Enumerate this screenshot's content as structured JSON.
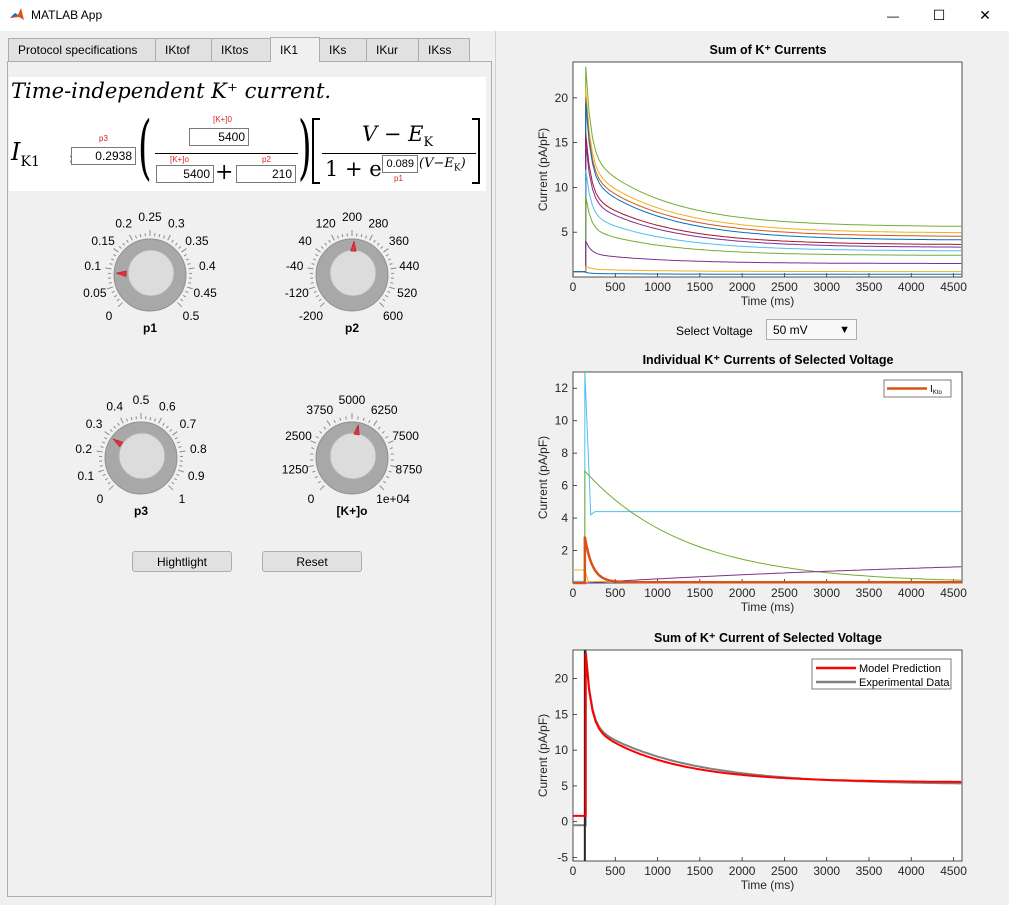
{
  "window": {
    "title": "MATLAB App",
    "minimize": "—",
    "maximize": "☐",
    "close": "✕"
  },
  "tabs": [
    "Protocol specifications",
    "IKtof",
    "IKtos",
    "IK1",
    "IKs",
    "IKur",
    "IKss"
  ],
  "active_tab": "IK1",
  "equation": {
    "title": "Time-independent K⁺ current.",
    "lhs": "I",
    "lhs_sub": "K1",
    "p3_label": "p3",
    "p3_value": "0.2938",
    "k_label_top": "[K+]0",
    "k_value_top": "5400",
    "k_label_bottom": "[K+]o",
    "k_value_bottom": "5400",
    "p2_label": "p2",
    "p2_value": "210",
    "numerator": "V − E",
    "numerator_sub": "K",
    "denominator_one": "1 + e",
    "p1_value": "0.089",
    "p1_label": "p1",
    "exponent_tail": "(V−E",
    "exponent_tail_sub": "K",
    "exponent_close": ")"
  },
  "knobs": {
    "p1": {
      "name": "p1",
      "ticks": [
        "0",
        "0.05",
        "0.1",
        "0.15",
        "0.2",
        "0.25",
        "0.3",
        "0.35",
        "0.4",
        "0.45",
        "0.5"
      ],
      "value": 0.089,
      "min": 0,
      "max": 0.5
    },
    "p2": {
      "name": "p2",
      "ticks": [
        "-200",
        "-120",
        "-40",
        "40",
        "120",
        "200",
        "280",
        "360",
        "440",
        "520",
        "600"
      ],
      "value": 210,
      "min": -200,
      "max": 600
    },
    "p3": {
      "name": "p3",
      "ticks": [
        "0",
        "0.1",
        "0.2",
        "0.3",
        "0.4",
        "0.5",
        "0.6",
        "0.7",
        "0.8",
        "0.9",
        "1"
      ],
      "value": 0.2938,
      "min": 0,
      "max": 1
    },
    "ko": {
      "name": "[K+]o",
      "ticks": [
        "0",
        "1250",
        "2500",
        "3750",
        "5000",
        "6250",
        "7500",
        "8750",
        "1e+04"
      ],
      "value": 5400,
      "min": 0,
      "max": 10000
    }
  },
  "buttons": {
    "highlight": "Hightlight",
    "reset": "Reset"
  },
  "select_voltage": {
    "label": "Select Voltage",
    "value": "50 mV",
    "arrow": "▼"
  },
  "colors": {
    "blue": "#0072bd",
    "orange": "#d95319",
    "yellow": "#edb120",
    "purple": "#7e2f8e",
    "green": "#77ac30",
    "cyan": "#4dbeee",
    "darkred": "#a2142f",
    "red": "#ff0000",
    "gray": "#808080"
  },
  "chart_data": [
    {
      "type": "line",
      "title": "Sum of K⁺ Currents",
      "xlabel": "Time (ms)",
      "ylabel": "Current (pA/pF)",
      "xlim": [
        0,
        4600
      ],
      "ylim": [
        0,
        24
      ],
      "xticks": [
        "0",
        "500",
        "1000",
        "1500",
        "2000",
        "2500",
        "3000",
        "3500",
        "4000",
        "4500"
      ],
      "yticks": [
        "5",
        "10",
        "15",
        "20"
      ],
      "series": [
        {
          "color": "#77ac30",
          "peak": 23.5,
          "end": 5.6
        },
        {
          "color": "#edb120",
          "peak": 21,
          "end": 4.9
        },
        {
          "color": "#d95319",
          "peak": 20,
          "end": 4.5
        },
        {
          "color": "#0072bd",
          "peak": 19.5,
          "end": 4.1
        },
        {
          "color": "#a2142f",
          "peak": 16,
          "end": 3.6
        },
        {
          "color": "#7e2f8e",
          "peak": 15,
          "end": 3.3
        },
        {
          "color": "#4dbeee",
          "peak": 12,
          "end": 2.9
        },
        {
          "color": "#77ac30",
          "peak": 9,
          "end": 2.4
        },
        {
          "color": "#7e2f8e",
          "peak": 4,
          "end": 1.5
        },
        {
          "color": "#edb120",
          "peak": 1.2,
          "end": 0.6
        },
        {
          "color": "#0072bd",
          "peak": 0.5,
          "end": 0.3
        }
      ]
    },
    {
      "type": "line",
      "title": "Individual K⁺ Currents of Selected Voltage",
      "xlabel": "Time (ms)",
      "ylabel": "Current (pA/pF)",
      "xlim": [
        0,
        4600
      ],
      "ylim": [
        0,
        13
      ],
      "xticks": [
        "0",
        "500",
        "1000",
        "1500",
        "2000",
        "2500",
        "3000",
        "3500",
        "4000",
        "4500"
      ],
      "yticks": [
        "2",
        "4",
        "6",
        "8",
        "10",
        "12"
      ],
      "legend": "top-right",
      "legend_entries": [
        "I",
        "Kto"
      ],
      "series": [
        {
          "name": "IKto",
          "color": "#d95319"
        },
        {
          "color": "#4dbeee",
          "steady": 4.4
        },
        {
          "color": "#77ac30",
          "peak": 6.9
        },
        {
          "color": "#7e2f8e",
          "end": 1.0
        },
        {
          "color": "#edb120",
          "initial": 0.8
        }
      ]
    },
    {
      "type": "line",
      "title": "Sum of K⁺ Current of Selected Voltage",
      "xlabel": "Time (ms)",
      "ylabel": "Current (pA/pF)",
      "xlim": [
        0,
        4600
      ],
      "ylim": [
        -5.5,
        24
      ],
      "xticks": [
        "0",
        "500",
        "1000",
        "1500",
        "2000",
        "2500",
        "3000",
        "3500",
        "4000",
        "4500"
      ],
      "yticks": [
        "-5",
        "0",
        "5",
        "10",
        "15",
        "20"
      ],
      "legend": "top-right",
      "series": [
        {
          "name": "Model Prediction",
          "color": "#ff0000",
          "peak": 23.5,
          "end": 5.5
        },
        {
          "name": "Experimental Data",
          "color": "#808080",
          "peak": 24,
          "end": 5.2
        }
      ]
    }
  ]
}
